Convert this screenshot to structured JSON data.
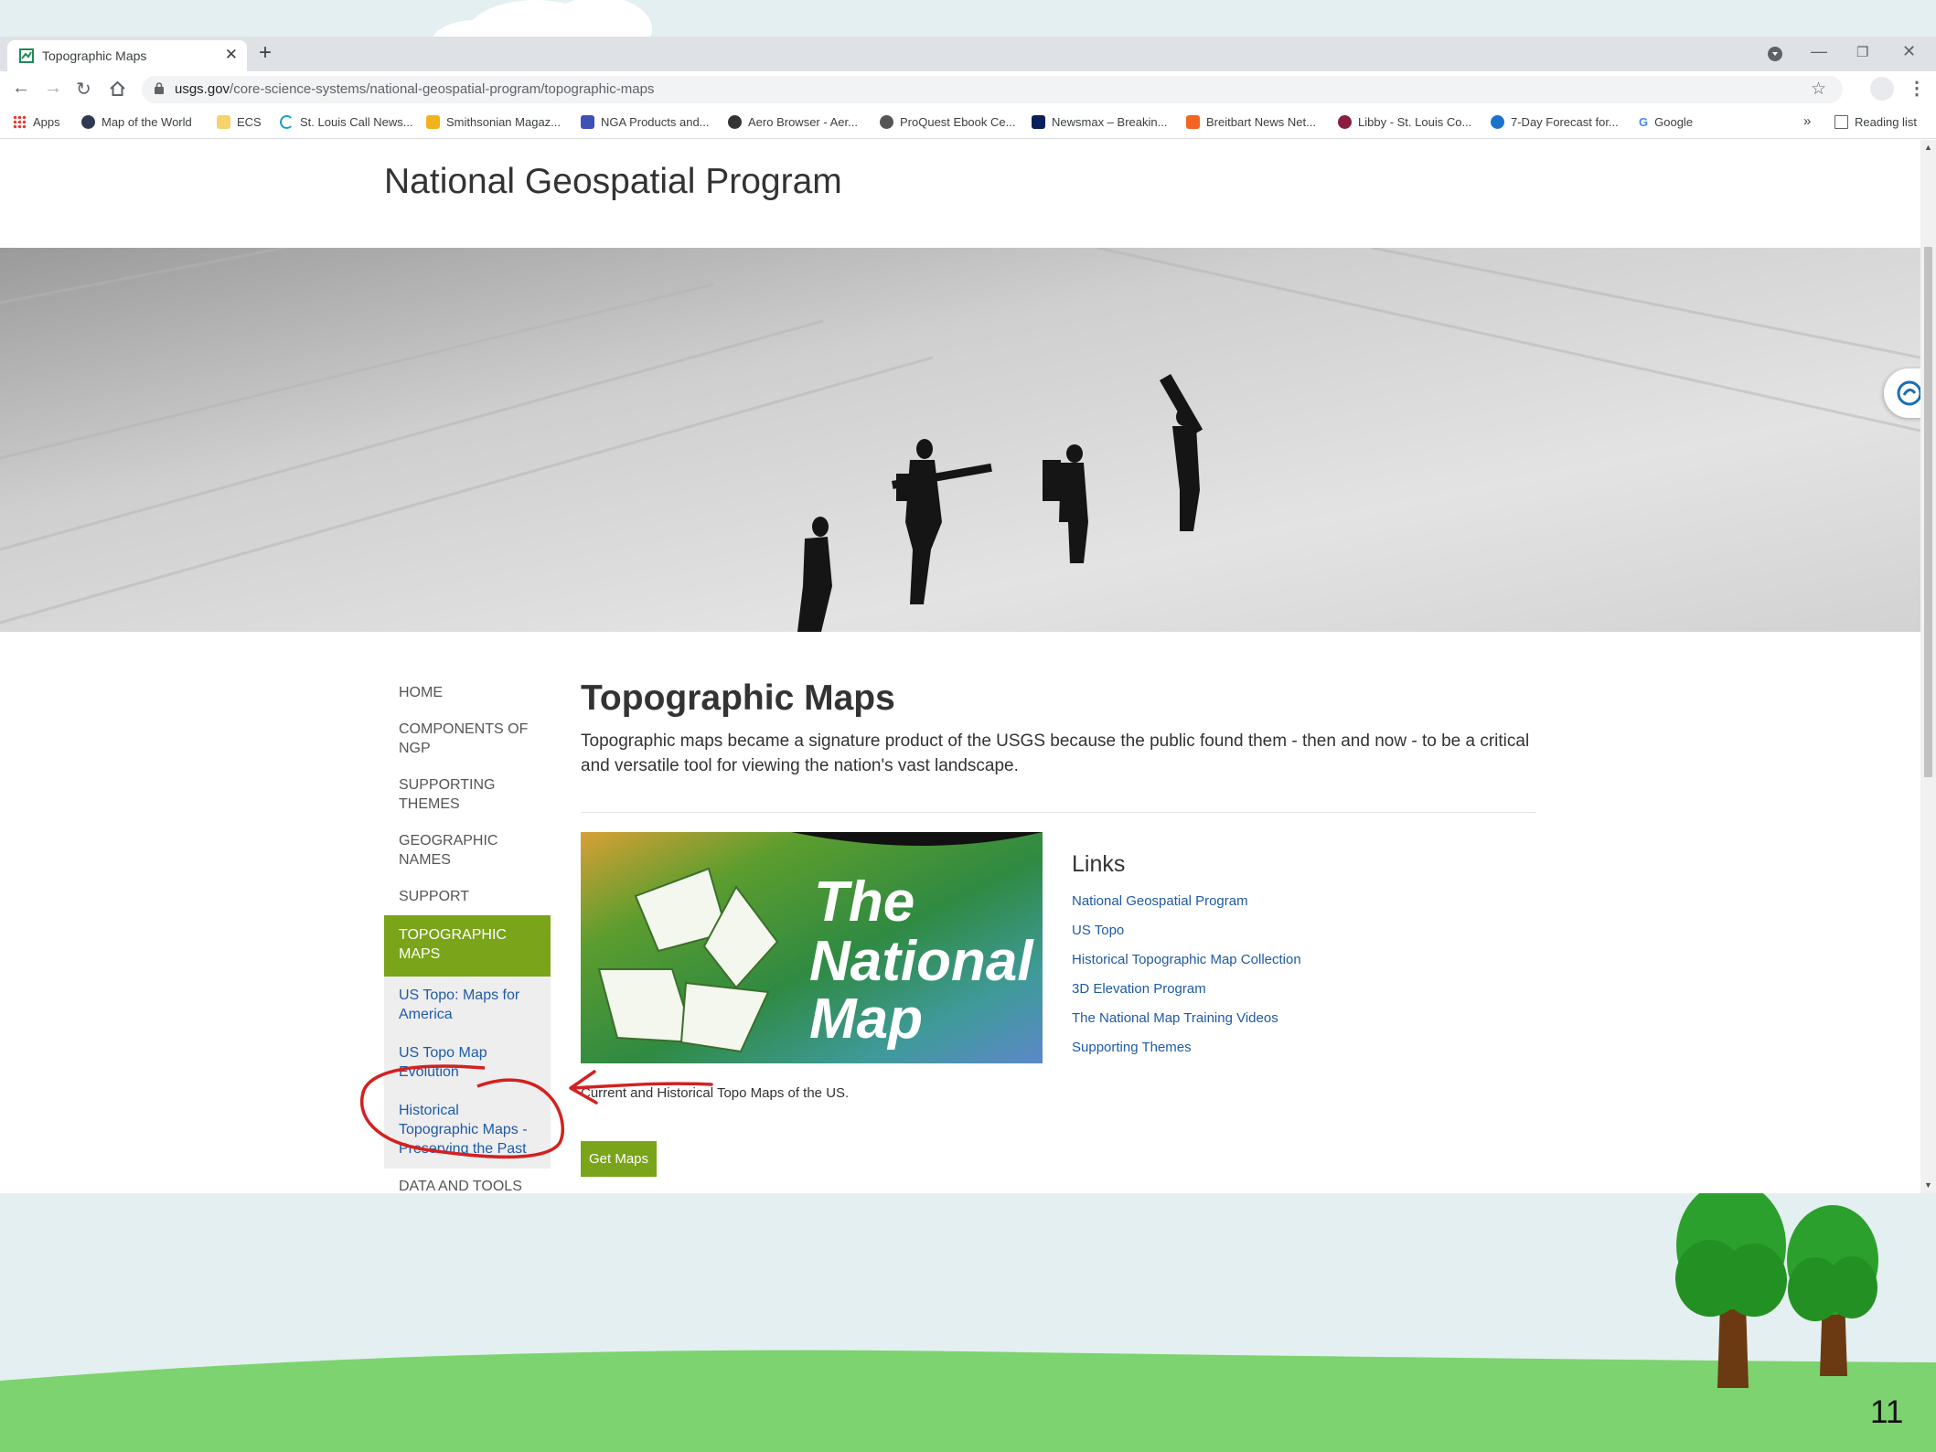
{
  "browser": {
    "tab_title": "Topographic Maps",
    "url_host": "usgs.gov",
    "url_path": "/core-science-systems/national-geospatial-program/topographic-maps",
    "bookmarks": [
      "Apps",
      "Map of the World",
      "ECS",
      "St. Louis Call News...",
      "Smithsonian Magaz...",
      "NGA Products and...",
      "Aero Browser - Aer...",
      "ProQuest Ebook Ce...",
      "Newsmax – Breakin...",
      "Breitbart News Net...",
      "Libby - St. Louis Co...",
      "7-Day Forecast for...",
      "Google"
    ],
    "more_bookmarks": "»",
    "reading_list": "Reading list"
  },
  "page": {
    "site_title": "National Geospatial Program",
    "nav": [
      "HOME",
      "COMPONENTS OF NGP",
      "SUPPORTING THEMES",
      "GEOGRAPHIC NAMES",
      "SUPPORT"
    ],
    "nav_active": "TOPOGRAPHIC MAPS",
    "nav_sub": [
      "US Topo: Maps for America",
      "US Topo Map Evolution",
      "Historical Topographic Maps - Preserving the Past"
    ],
    "nav_after": "DATA AND TOOLS",
    "title": "Topographic Maps",
    "lead": "Topographic maps became a signature product of the USGS because the public found them - then and now - to be a critical and versatile tool for viewing the nation's vast landscape.",
    "image_text": [
      "The",
      "National",
      "Map"
    ],
    "caption": "Current and Historical Topo Maps of the US.",
    "button": "Get Maps",
    "links_heading": "Links",
    "links": [
      "National Geospatial Program",
      "US Topo",
      "Historical Topographic Map Collection",
      "3D Elevation Program",
      "The National Map Training Videos",
      "Supporting Themes"
    ]
  },
  "slide": {
    "number": "11",
    "colors": {
      "annotation": "#d42020",
      "usgs_green": "#7aa419",
      "link_blue": "#1f5aa6"
    }
  }
}
